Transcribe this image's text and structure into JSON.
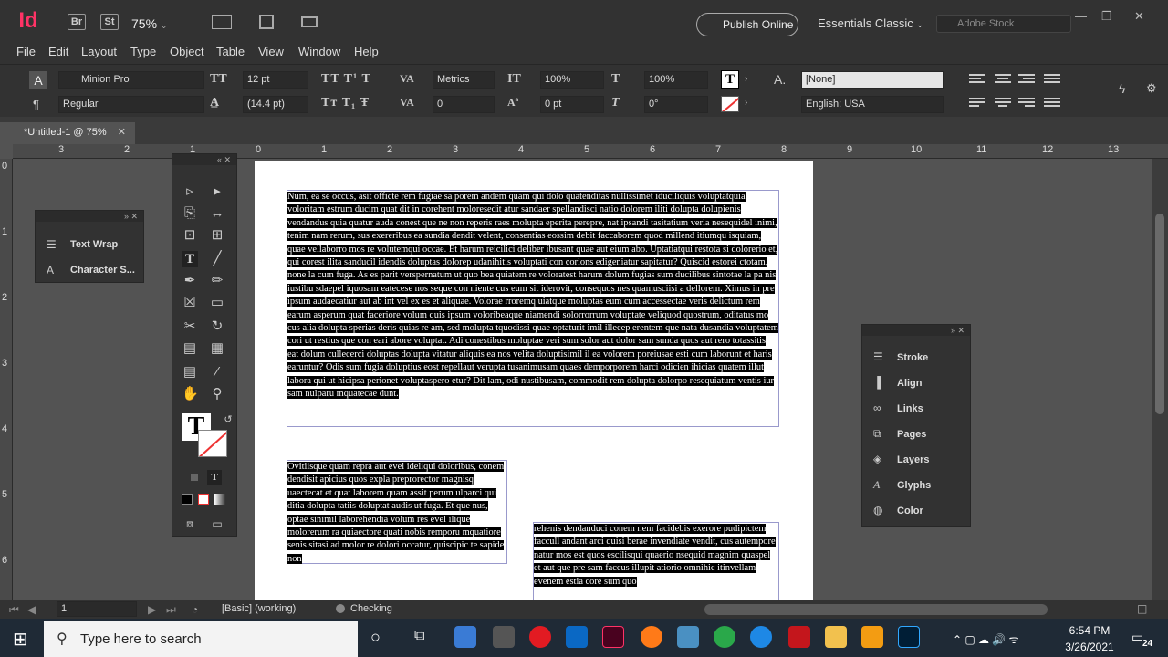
{
  "titlebar": {
    "app_icon": "Id",
    "bridge": "Br",
    "stock_btn": "St",
    "zoom": "75%",
    "publish": "Publish Online",
    "workspace": "Essentials Classic",
    "search_placeholder": "Adobe Stock"
  },
  "menu": [
    "File",
    "Edit",
    "Layout",
    "Type",
    "Object",
    "Table",
    "View",
    "Window",
    "Help"
  ],
  "control": {
    "font": "Minion Pro",
    "style": "Regular",
    "size": "12 pt",
    "leading": "(14.4 pt)",
    "kerning": "Metrics",
    "tracking": "0",
    "vscale": "100%",
    "hscale": "100%",
    "baseline": "0 pt",
    "skew": "0°",
    "charstyle": "[None]",
    "language": "English: USA"
  },
  "tab": {
    "title": "*Untitled-1 @ 75%"
  },
  "ruler_h": [
    "3",
    "2",
    "1",
    "0",
    "1",
    "2",
    "3",
    "4",
    "5",
    "6",
    "7",
    "8",
    "9",
    "10",
    "11",
    "12",
    "13"
  ],
  "ruler_v": [
    "0",
    "1",
    "2",
    "3",
    "4",
    "5",
    "6"
  ],
  "text_frames": {
    "main": "Num, ea se occus, asit officte rem fugiae sa porem andem quam qui dolo quatenditas nullissimet iduciliquis voluptatquia voloritam estrum ducim quat dit in corehent moloresedit atur sandaer spellandisci natio dolorem iliti dolupta dolupienis vendandus quia quatur auda conest que ne non reperis raes molupta eperita perepre, nat ipsandi tasitatium veria nesequidel inimi, tenim nam rerum, sus exereribus ea sundia dendit velent, consentias eossim debit faccaborem quod millend itiumqu isquiam, quae vellaborro mos re volutemqui occae. Et harum reicilici deliber ibusant quae aut eium abo. Uptatiatqui restota si dolorerio et, qui corest ilita sanducil idendis doluptas dolorep udanihitis voluptati con corions edigeniatur sapitatur? Quiscid estorei ctotam, none la cum fuga. As es parit verspernatum ut quo bea quiatem re voloratest harum dolum fugias sum ducilibus sintotae la pa nis iustibu sdaepel iquosam eatecese nos seque con niente cus eum sit iderovit, consequos nes quamusciisi a dellorem. Ximus in pre ipsum audaecatiur aut ab int vel ex es et aliquae. Volorae rroremq uiatque moluptas eum cum accessectae veris delictum rem earum asperum quat faceriore volum quis ipsum voloribeaque niamendi solorrorrum voluptate veliquod quostrum, oditatus mo cus alia dolupta sperias deris quias re am, sed molupta tquodissi quae optaturit imil illecep erentem que nata dusandia voluptatem cori ut restius que con eari abore voluptat. Adi conestibus moluptae veri sum solor aut dolor sam sunda quos aut rero totassitis eat dolum cullecerci doluptas dolupta vitatur aliquis ea nos velita doluptisimil il ea volorem poreiusae esti cum laborunt et haris earuntur? Odis sum fugia doluptius eost repellaut verupta tusanimusam quaes demporporem harci odicien ihicias quatem illut labora qui ut hicipsa perionet voluptaspero etur? Dit lam, odi nustibusam, commodit rem dolupta dolorpo resequiatum ventis iur sam nulparu mquatecae dunt.",
    "left": "Ovitiisque quam repra aut evel ideliqui doloribus, conem dendisit apicius quos expla preprorector magnisq uaectecat et quat laborem quam assit perum ulparci qui ditia dolupta tatiis doluptat audis ut fuga. Et que nus, optae sinimil laborehendia volum res evel ilique molorerum ra quiaectore quati nobis remporu mquatiore senis sitasi ad molor re dolori occatur, quiscipic te sapide non",
    "right": "rehenis dendanduci conem nem facidebis exerore pudipictem faccull andant arci quisi berae invendiate vendit, cus autempore natur mos est quos escilisqui quaerio nsequid magnim quaspel et aut que pre sam faccus illupit atiorio omnihic itinvellam evenem estia core sum quo"
  },
  "left_panel": [
    "Text Wrap",
    "Character S..."
  ],
  "right_panel": [
    "Stroke",
    "Align",
    "Links",
    "Pages",
    "Layers",
    "Glyphs",
    "Color"
  ],
  "status": {
    "page": "1",
    "style": "[Basic] (working)",
    "preflight": "Checking"
  },
  "taskbar": {
    "search": "Type here to search",
    "time": "6:54 PM",
    "date": "3/26/2021",
    "notif": "24"
  }
}
